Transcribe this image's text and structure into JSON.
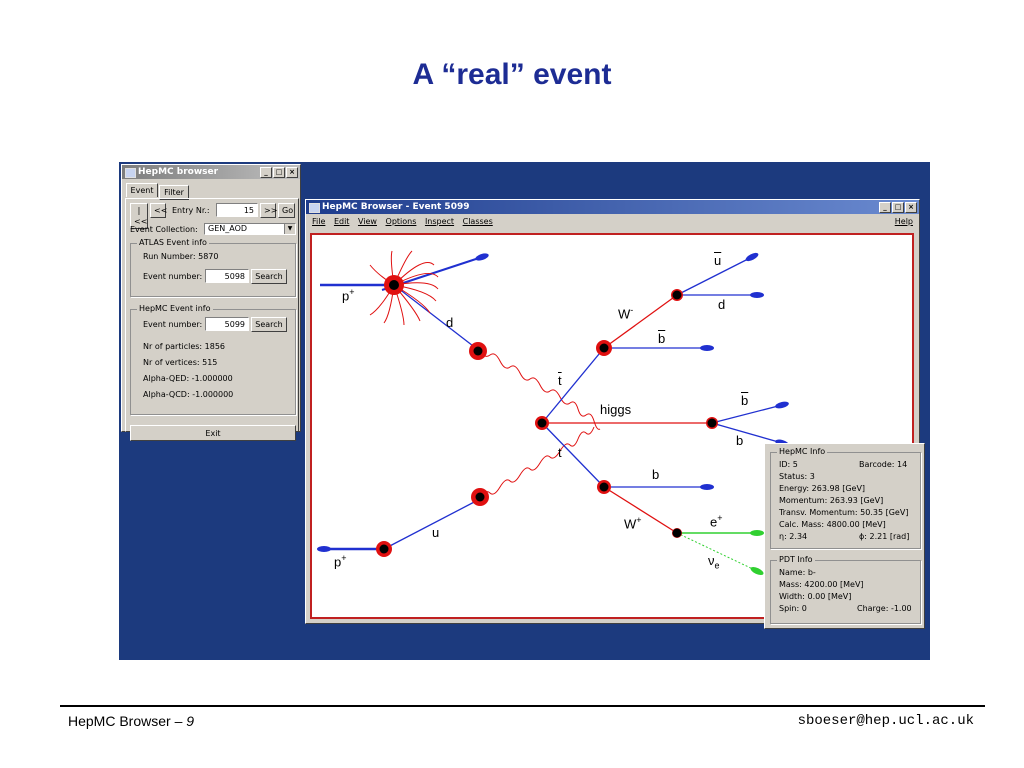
{
  "slide": {
    "title": "A “real” event",
    "footer_left": "HepMC Browser – ",
    "footer_page": "9",
    "footer_right": "sboeser@hep.ucl.ac.uk"
  },
  "browser_window": {
    "title": "HepMC browser",
    "tabs": [
      "Event",
      "Filter"
    ],
    "first_button": "|<<",
    "prev_button": "<<",
    "entry_label": "Entry Nr.:",
    "entry_value": "15",
    "next_button": ">>",
    "go_button": "Go",
    "collection_label": "Event Collection:",
    "collection_value": "GEN_AOD",
    "atlas_group": "ATLAS Event info",
    "run_number": "Run Number: 5870",
    "atlas_event_label": "Event number:",
    "atlas_event_value": "5098",
    "search_button": "Search",
    "hepmc_group": "HepMC Event info",
    "hepmc_event_label": "Event number:",
    "hepmc_event_value": "5099",
    "nr_particles": "Nr of particles: 1856",
    "nr_vertices": "Nr of vertices: 515",
    "alpha_qed": "Alpha-QED: -1.000000",
    "alpha_qcd": "Alpha-QCD: -1.000000",
    "exit_button": "Exit"
  },
  "event_window": {
    "title": "HepMC Browser - Event 5099",
    "menu": [
      "File",
      "Edit",
      "View",
      "Options",
      "Inspect",
      "Classes"
    ],
    "help": "Help",
    "labels": {
      "p_top": "p",
      "p_top_sup": "+",
      "d_left": "d",
      "u_bar": "u",
      "d_right": "d",
      "w_minus": "W",
      "w_minus_sup": "-",
      "b_bar_top": "b",
      "t_bar": "t",
      "higgs": "higgs",
      "b_bar_mid": "b",
      "b_mid": "b",
      "t": "t",
      "b_low": "b",
      "w_plus": "W",
      "w_plus_sup": "+",
      "e_plus": "e",
      "e_plus_sup": "+",
      "u_low": "u",
      "nu": "ν",
      "nu_sub": "e",
      "p_bottom": "p",
      "p_bottom_sup": "+"
    }
  },
  "info_panel": {
    "hepmc_group": "HepMC Info",
    "id": "ID: 5",
    "barcode": "Barcode: 14",
    "status": "Status: 3",
    "energy": "Energy: 263.98 [GeV]",
    "momentum": "Momentum: 263.93 [GeV]",
    "transv": "Transv. Momentum: 50.35 [GeV]",
    "calc_mass": "Calc. Mass: 4800.00 [MeV]",
    "eta": "η: 2.34",
    "phi": "ϕ: 2.21 [rad]",
    "pdt_group": "PDT Info",
    "name": "Name: b-",
    "mass": "Mass: 4200.00 [MeV]",
    "width": "Width: 0.00 [MeV]",
    "spin": "Spin: 0",
    "charge": "Charge: -1.00"
  },
  "colors": {
    "title": "#1d2c94",
    "desktop": "#1c3a7e",
    "quark_line": "#2030d0",
    "vertex_red": "#e01010",
    "lepton": "#30d030"
  }
}
